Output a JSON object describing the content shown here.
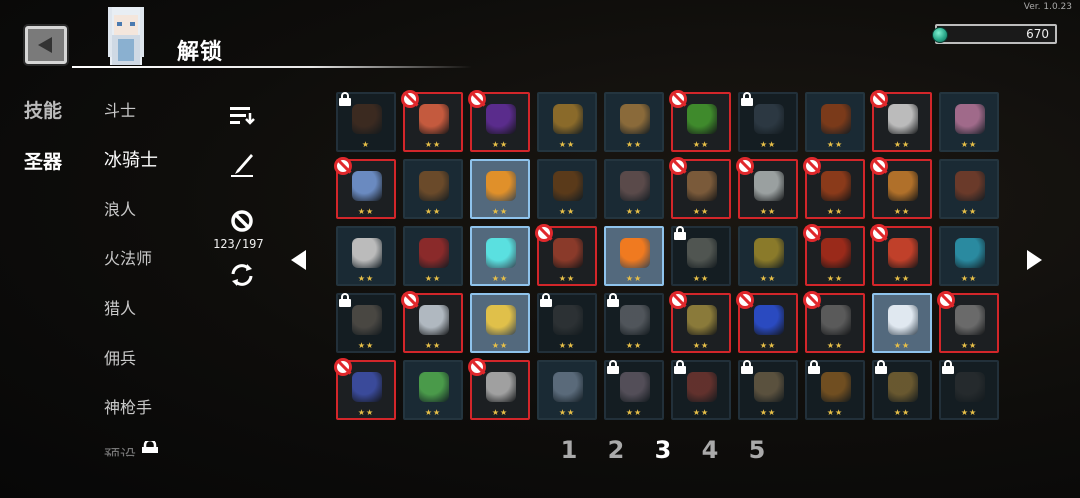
{
  "version": "Ver. 1.0.23",
  "header": {
    "title": "解锁",
    "currency_value": "670",
    "back_icon": "back-arrow-icon",
    "currency_icon": "gem-icon"
  },
  "categories": [
    {
      "label": "技能",
      "active": false
    },
    {
      "label": "圣器",
      "active": true
    }
  ],
  "characters": [
    {
      "label": "斗士"
    },
    {
      "label": "冰骑士"
    },
    {
      "label": "浪人"
    },
    {
      "label": "火法师"
    },
    {
      "label": "猎人"
    },
    {
      "label": "佣兵"
    },
    {
      "label": "神枪手"
    },
    {
      "label": "预设"
    }
  ],
  "tools": {
    "sort_icon": "sort-icon",
    "edit_icon": "quill-icon",
    "ban_icon": "ban-icon",
    "ban_count": "123/197",
    "refresh_icon": "refresh-icon"
  },
  "colors": {
    "banned_border": "#d3262a",
    "selected_border": "#8fc3ec",
    "stars": "#e8c048"
  },
  "relic_rows": [
    [
      {
        "state": "locked",
        "stars": "★",
        "icon": "#6b3a1e"
      },
      {
        "state": "banned",
        "stars": "★★",
        "icon": "#c45a3e"
      },
      {
        "state": "banned",
        "stars": "★★",
        "icon": "#5a2c8c"
      },
      {
        "state": "normal",
        "stars": "★★",
        "icon": "#8a6a2a"
      },
      {
        "state": "normal",
        "stars": "★★",
        "icon": "#8a6a3a"
      },
      {
        "state": "banned",
        "stars": "★★",
        "icon": "#3f8a2c"
      },
      {
        "state": "locked",
        "stars": "★★",
        "icon": "#4a5a6a"
      },
      {
        "state": "normal",
        "stars": "★★",
        "icon": "#7a3a1a"
      },
      {
        "state": "banned",
        "stars": "★★",
        "icon": "#bbbbbb"
      },
      {
        "state": "normal",
        "stars": "★★",
        "icon": "#a06a8a"
      }
    ],
    [
      {
        "state": "banned",
        "stars": "★★",
        "icon": "#6a8ac0"
      },
      {
        "state": "normal",
        "stars": "★★",
        "icon": "#6a4a2a"
      },
      {
        "state": "selected",
        "stars": "★★",
        "icon": "#e0902a"
      },
      {
        "state": "normal",
        "stars": "★★",
        "icon": "#5a3a1a"
      },
      {
        "state": "normal",
        "stars": "★★",
        "icon": "#5a4a4a"
      },
      {
        "state": "banned",
        "stars": "★★",
        "icon": "#7a5a3a"
      },
      {
        "state": "banned",
        "stars": "★★",
        "icon": "#9aa0a0"
      },
      {
        "state": "banned",
        "stars": "★★",
        "icon": "#8a3a1a"
      },
      {
        "state": "banned",
        "stars": "★★",
        "icon": "#b0702a"
      },
      {
        "state": "normal",
        "stars": "★★",
        "icon": "#6a3a2a"
      }
    ],
    [
      {
        "state": "normal",
        "stars": "★★",
        "icon": "#bbbbbb"
      },
      {
        "state": "normal",
        "stars": "★★",
        "icon": "#8a2a2a"
      },
      {
        "state": "selected",
        "stars": "★★",
        "icon": "#5ae0e0"
      },
      {
        "state": "banned",
        "stars": "★★",
        "icon": "#8a3a2a"
      },
      {
        "state": "selected",
        "stars": "★★",
        "icon": "#f07a20"
      },
      {
        "state": "locked",
        "stars": "★★",
        "icon": "#9a9a8a"
      },
      {
        "state": "normal",
        "stars": "★★",
        "icon": "#8a7a2a"
      },
      {
        "state": "banned",
        "stars": "★★",
        "icon": "#9a2a1a"
      },
      {
        "state": "banned",
        "stars": "★★",
        "icon": "#c0402a"
      },
      {
        "state": "normal",
        "stars": "★★",
        "icon": "#2a8aa0"
      }
    ],
    [
      {
        "state": "locked",
        "stars": "★★",
        "icon": "#8a7a6a"
      },
      {
        "state": "banned",
        "stars": "★★",
        "icon": "#b0b8c0"
      },
      {
        "state": "selected",
        "stars": "★★",
        "icon": "#e0c04a"
      },
      {
        "state": "locked",
        "stars": "★★",
        "icon": "#4a4a4a"
      },
      {
        "state": "locked",
        "stars": "★★",
        "icon": "#9a9aa0"
      },
      {
        "state": "banned",
        "stars": "★★",
        "icon": "#8a7a3a"
      },
      {
        "state": "banned",
        "stars": "★★",
        "icon": "#2a4ac0"
      },
      {
        "state": "banned",
        "stars": "★★",
        "icon": "#5a5a5a"
      },
      {
        "state": "selected",
        "stars": "★★",
        "icon": "#e0e8f0"
      },
      {
        "state": "banned",
        "stars": "★★",
        "icon": "#6a6a6a"
      }
    ],
    [
      {
        "state": "banned",
        "stars": "★★",
        "icon": "#3a4a9a"
      },
      {
        "state": "normal",
        "stars": "★★",
        "icon": "#4a9a4a"
      },
      {
        "state": "banned",
        "stars": "★★",
        "icon": "#a0a0a0"
      },
      {
        "state": "normal",
        "stars": "★★",
        "icon": "#5a6a7a"
      },
      {
        "state": "locked",
        "stars": "★★",
        "icon": "#a08a9a"
      },
      {
        "state": "locked",
        "stars": "★★",
        "icon": "#c04a3a"
      },
      {
        "state": "locked",
        "stars": "★★",
        "icon": "#b09060"
      },
      {
        "state": "locked",
        "stars": "★★",
        "icon": "#e08a20"
      },
      {
        "state": "locked",
        "stars": "★★",
        "icon": "#d0a040"
      },
      {
        "state": "locked",
        "stars": "★★",
        "icon": "#3a3a3a"
      }
    ]
  ],
  "pagination": {
    "pages": [
      "1",
      "2",
      "3",
      "4",
      "5"
    ],
    "active_page": "3",
    "prev_icon": "triangle-left-icon",
    "next_icon": "triangle-right-icon"
  }
}
